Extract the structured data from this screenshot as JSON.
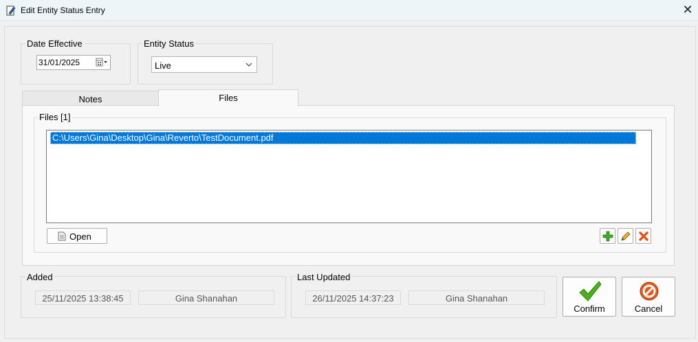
{
  "window": {
    "title": "Edit Entity Status Entry"
  },
  "date_effective": {
    "label": "Date Effective",
    "value": "31/01/2025"
  },
  "entity_status": {
    "label": "Entity Status",
    "value": "Live"
  },
  "tabs": [
    {
      "label": "Notes",
      "selected": false
    },
    {
      "label": "Files",
      "selected": true
    }
  ],
  "files": {
    "group_label": "Files [1]",
    "items": [
      "C:\\Users\\Gina\\Desktop\\Gina\\Reverto\\TestDocument.pdf"
    ],
    "open_label": "Open"
  },
  "added": {
    "label": "Added",
    "timestamp": "25/11/2025 13:38:45",
    "user": "Gina Shanahan"
  },
  "last_updated": {
    "label": "Last Updated",
    "timestamp": "26/11/2025 14:37:23",
    "user": "Gina Shanahan"
  },
  "buttons": {
    "confirm": "Confirm",
    "cancel": "Cancel"
  },
  "icons": {
    "app": "pencil-notepad-icon",
    "calendar": "calendar-icon",
    "add": "plus-icon",
    "edit": "pencil-icon",
    "delete": "x-icon",
    "confirm": "checkmark-icon",
    "cancel": "no-entry-icon"
  },
  "colors": {
    "selection": "#0078d7",
    "add": "#3fa92b",
    "delete": "#e4571c",
    "confirm": "#4caf1e",
    "cancel": "#e4571c"
  }
}
